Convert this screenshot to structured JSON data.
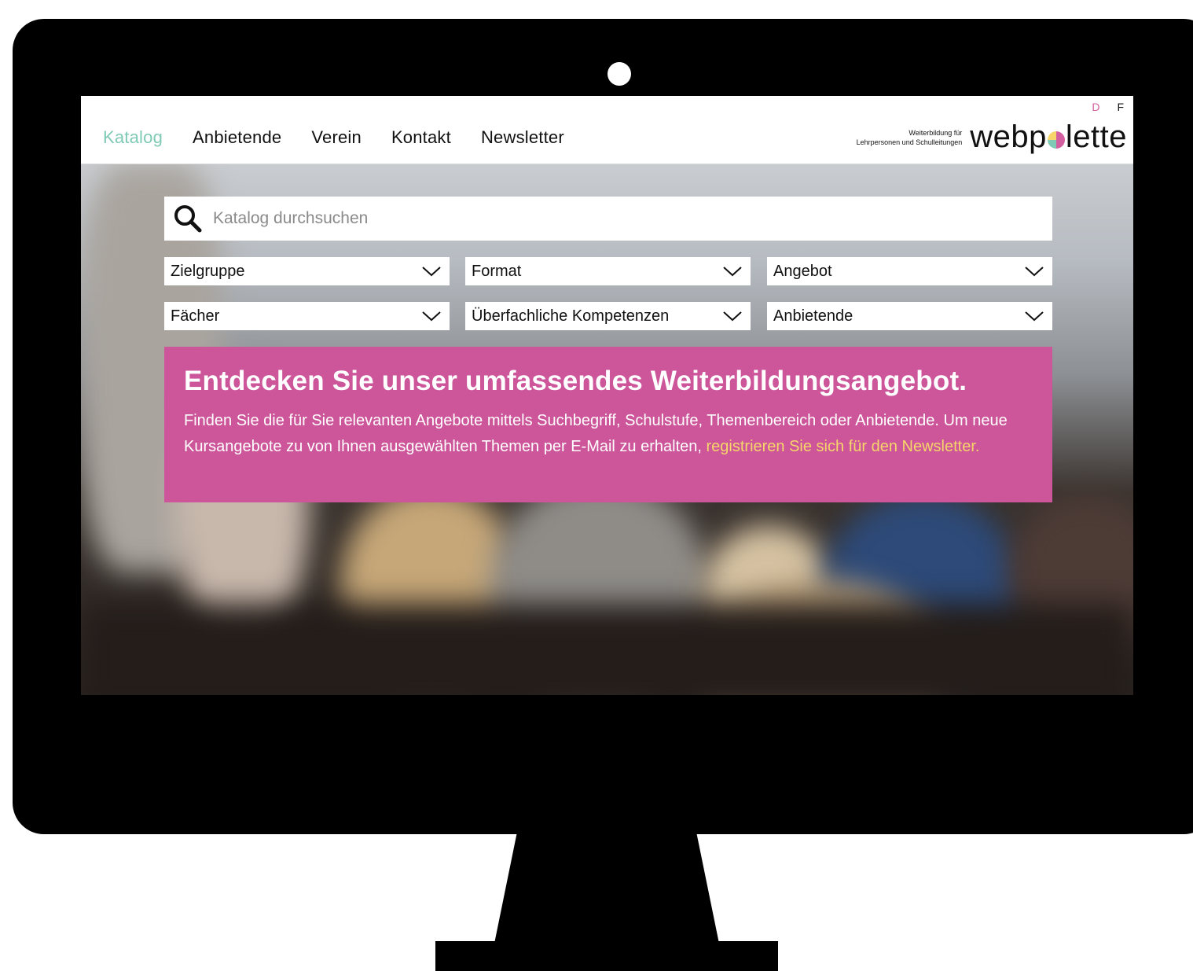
{
  "nav": {
    "items": [
      {
        "label": "Katalog",
        "active": true
      },
      {
        "label": "Anbietende",
        "active": false
      },
      {
        "label": "Verein",
        "active": false
      },
      {
        "label": "Kontakt",
        "active": false
      },
      {
        "label": "Newsletter",
        "active": false
      }
    ]
  },
  "lang": {
    "d": "D",
    "f": "F"
  },
  "brand": {
    "tagline_line1": "Weiterbildung für",
    "tagline_line2": "Lehrpersonen und Schulleitungen",
    "logo_part1": "web",
    "logo_p": "p",
    "logo_part2": "lette"
  },
  "search": {
    "placeholder": "Katalog durchsuchen",
    "value": ""
  },
  "filters": {
    "zielgruppe": "Zielgruppe",
    "format": "Format",
    "angebot": "Angebot",
    "faecher": "Fächer",
    "kompetenzen": "Überfachliche Kompetenzen",
    "anbietende": "Anbietende"
  },
  "promo": {
    "title": "Entdecken Sie unser umfassendes Weiterbildungsangebot.",
    "text": "Finden Sie die für Sie relevanten Angebote mittels Suchbegriff, Schulstufe, Themenbereich oder Anbietende. Um neue Kursangebote zu von Ihnen ausgewählten Themen per E-Mail zu erhalten, ",
    "link": "registrieren Sie sich für den Newsletter."
  },
  "colors": {
    "accent_green": "#7fcab5",
    "accent_pink": "#cd559a",
    "link_yellow": "#f6d56a",
    "lang_active": "#d35fa0"
  }
}
